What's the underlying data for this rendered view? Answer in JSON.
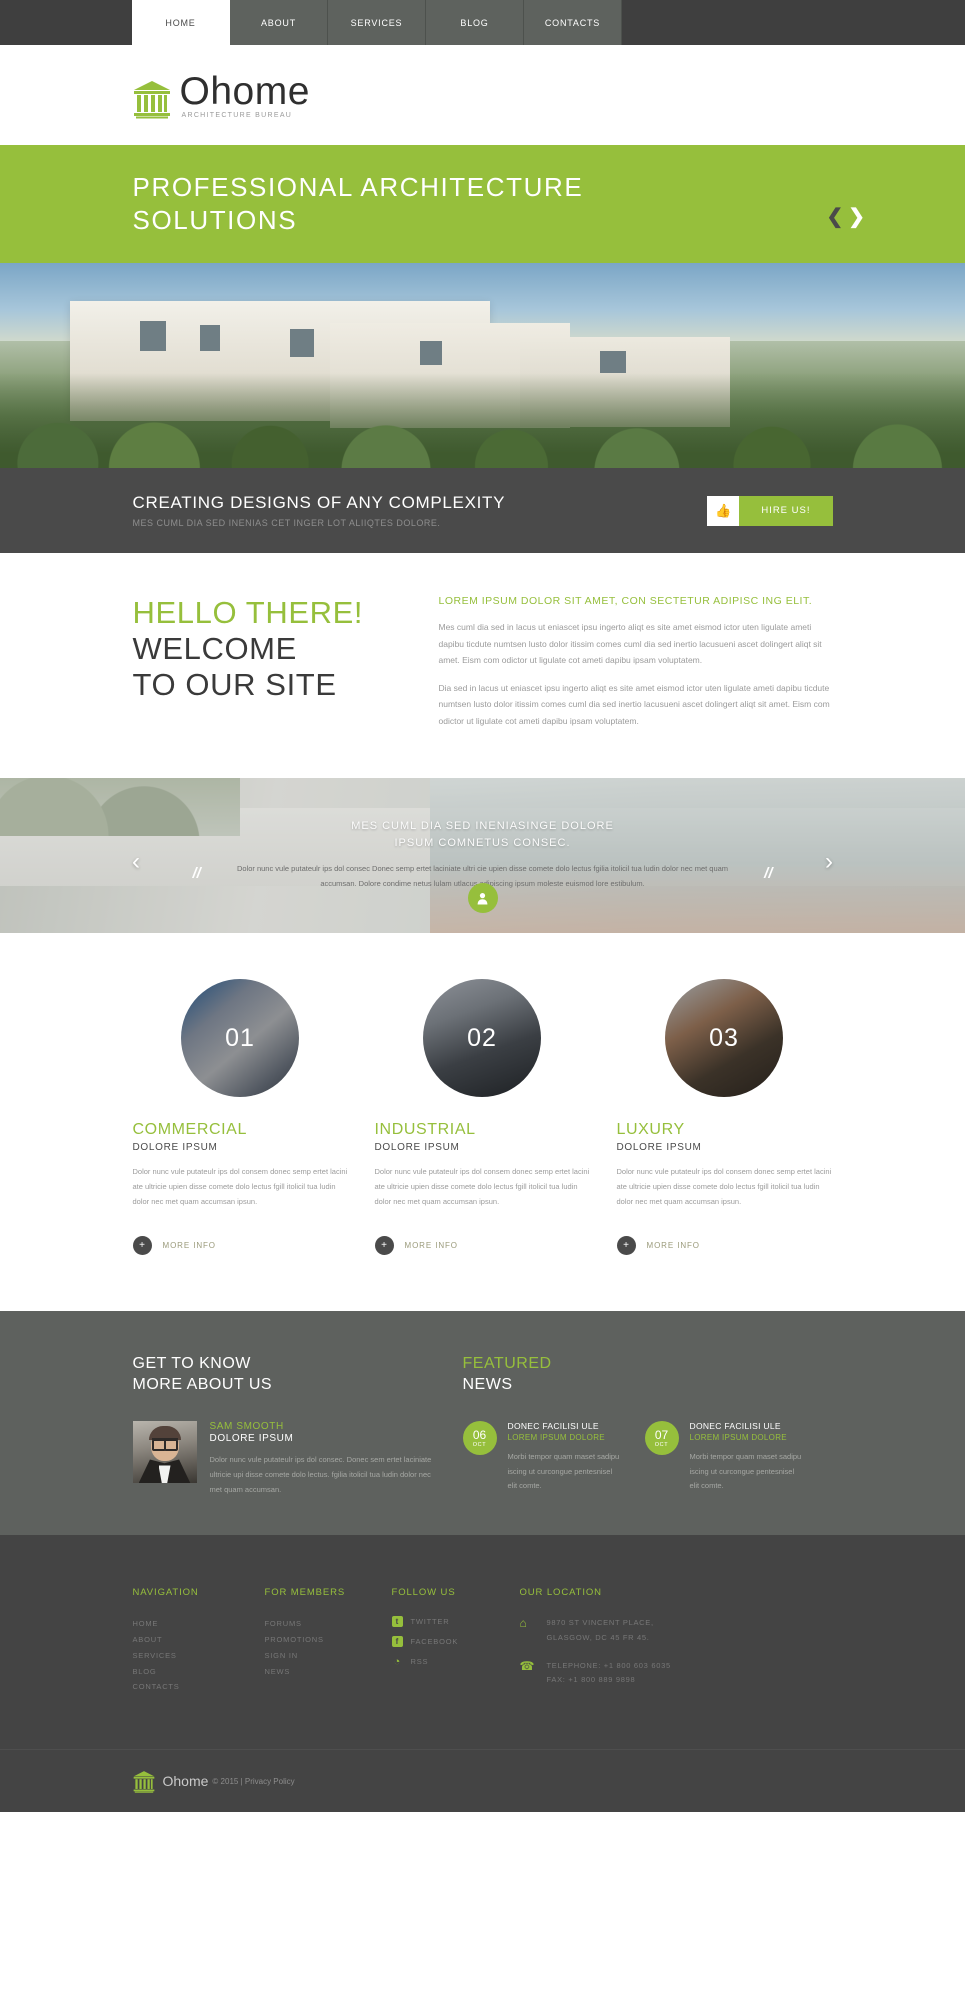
{
  "nav": {
    "items": [
      {
        "label": "HOME",
        "active": true
      },
      {
        "label": "ABOUT",
        "active": false
      },
      {
        "label": "SERVICES",
        "active": false
      },
      {
        "label": "BLOG",
        "active": false
      },
      {
        "label": "CONTACTS",
        "active": false
      }
    ]
  },
  "logo": {
    "name": "Ohome",
    "tagline": "ARCHITECTURE BUREAU"
  },
  "banner": {
    "title_line1": "PROFESSIONAL ARCHITECTURE",
    "title_line2": "SOLUTIONS",
    "prev": "❮",
    "next": "❯",
    "color": "#96bf3c"
  },
  "cta": {
    "title": "CREATING DESIGNS OF ANY COMPLEXITY",
    "subtitle": "MES CUML DIA SED INENIAS CET INGER LOT ALIIQTES DOLORE.",
    "icon": "👍",
    "button_label": "HIRE US!"
  },
  "welcome": {
    "heading_green": "HELLO THERE!",
    "heading_dark_line1": "WELCOME",
    "heading_dark_line2": "TO OUR SITE",
    "lead": "LOREM IPSUM DOLOR SIT AMET, CON SECTETUR ADIPISC ING ELIT.",
    "paragraph1": "Mes cuml dia sed in lacus ut eniascet ipsu ingerto aliqt es site amet eismod ictor uten ligulate ameti dapibu ticdute numtsen lusto dolor itissim comes cuml dia sed inertio lacusueni ascet dolingert aliqt sit amet. Eism com odictor ut ligulate cot ameti dapibu ipsam voluptatem.",
    "paragraph2": "Dia sed in lacus ut eniascet ipsu ingerto aliqt es site amet eismod ictor uten ligulate ameti dapibu ticdute numtsen lusto dolor itissim comes cuml dia sed inertio lacusueni ascet dolingert aliqt sit amet. Eism com odictor ut ligulate cot ameti dapibu ipsam voluptatem."
  },
  "quote": {
    "title_line1": "MES CUML DIA SED INENIASINGE DOLORE",
    "title_line2": "IPSUM COMNETUS CONSEC.",
    "text": "Dolor nunc vule putateulr ips dol consec Donec semp ertet laciniate ultri cie upien disse comete dolo lectus fgilia itolicil tua ludin dolor nec met quam accumsan. Dolore condime netus lulam utlacus adipiscing ipsum moleste euismod lore estibulum.",
    "quote_mark": "//",
    "prev": "‹",
    "next": "›",
    "avatar_icon": "person-icon"
  },
  "services": [
    {
      "number": "01",
      "title": "COMMERCIAL",
      "subtitle": "DOLORE IPSUM",
      "text": "Dolor nunc vule putateulr ips dol consem donec semp ertet lacini ate ultricie upien disse comete dolo lectus fgill itolicil tua ludin dolor nec met quam accumsan ipsun.",
      "more_label": "MORE INFO",
      "plus": "+"
    },
    {
      "number": "02",
      "title": "INDUSTRIAL",
      "subtitle": "DOLORE IPSUM",
      "text": "Dolor nunc vule putateulr ips dol consem donec semp ertet lacini ate ultricie upien disse comete dolo lectus fgill itolicil tua ludin dolor nec met quam accumsan ipsun.",
      "more_label": "MORE INFO",
      "plus": "+"
    },
    {
      "number": "03",
      "title": "LUXURY",
      "subtitle": "DOLORE IPSUM",
      "text": "Dolor nunc vule putateulr ips dol consem donec semp ertet lacini ate ultricie upien disse comete dolo lectus fgill itolicil tua ludin dolor nec met quam accumsan ipsun.",
      "more_label": "MORE INFO",
      "plus": "+"
    }
  ],
  "about": {
    "heading_line1": "GET TO KNOW",
    "heading_line2": "MORE ABOUT US",
    "person_name": "SAM SMOOTH",
    "person_role": "DOLORE IPSUM",
    "person_text": "Dolor nunc vule putateulr ips dol consec. Donec sem ertet laciniate ultricie upi disse comete dolo lectus. fgilia itolicil tua ludin dolor nec met quam accumsan."
  },
  "news": {
    "heading_green": "FEATURED",
    "heading_white": "NEWS",
    "items": [
      {
        "day": "06",
        "month": "OCT",
        "title": "DONEC FACILISI ULE",
        "subtitle": "LOREM IPSUM DOLORE",
        "text": "Morbi tempor quam maset sadipu iscing ut curcongue pentesnisel elit comte."
      },
      {
        "day": "07",
        "month": "OCT",
        "title": "DONEC FACILISI ULE",
        "subtitle": "LOREM IPSUM DOLORE",
        "text": "Morbi tempor quam maset sadipu iscing ut curcongue pentesnisel elit comte."
      }
    ]
  },
  "footer": {
    "navigation": {
      "heading": "NAVIGATION",
      "links": [
        "HOME",
        "ABOUT",
        "SERVICES",
        "BLOG",
        "CONTACTS"
      ]
    },
    "members": {
      "heading": "FOR MEMBERS",
      "links": [
        "FORUMS",
        "PROMOTIONS",
        "SIGN IN",
        "NEWS"
      ]
    },
    "follow": {
      "heading": "FOLLOW US",
      "items": [
        {
          "label": "TWITTER",
          "icon": "twitter-icon",
          "glyph": "t"
        },
        {
          "label": "FACEBOOK",
          "icon": "facebook-icon",
          "glyph": "f"
        },
        {
          "label": "RSS",
          "icon": "rss-icon",
          "glyph": "◔"
        }
      ]
    },
    "location": {
      "heading": "OUR LOCATION",
      "address_line1": "9870 ST VINCENT PLACE,",
      "address_line2": "GLASGOW, DC 45 FR 45.",
      "phone_line1": "TELEPHONE: +1 800 603 6035",
      "phone_line2": "FAX: +1 800 889 9898",
      "home_icon": "⌂",
      "phone_icon": "☎"
    },
    "bottom": {
      "brand": "Ohome",
      "copyright": "© 2015 | Privacy Policy"
    }
  }
}
